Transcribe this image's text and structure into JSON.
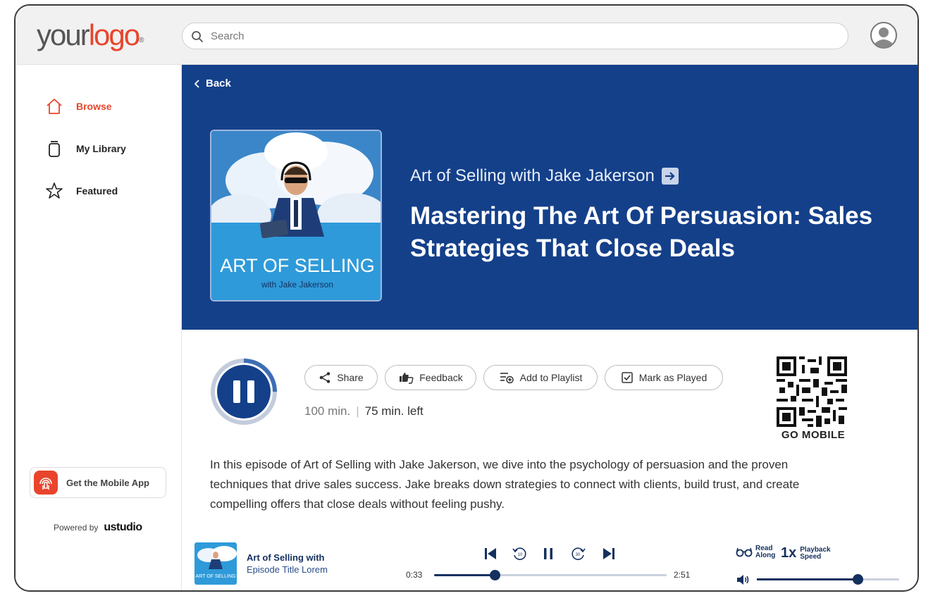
{
  "header": {
    "logo_part1": "your",
    "logo_part2": "logo",
    "logo_mark": "®",
    "search_placeholder": "Search",
    "avatar_icon": "user-avatar-icon"
  },
  "sidebar": {
    "items": [
      {
        "label": "Browse",
        "icon": "home-icon",
        "active": true
      },
      {
        "label": "My Library",
        "icon": "library-icon",
        "active": false
      },
      {
        "label": "Featured",
        "icon": "star-icon",
        "active": false
      }
    ],
    "get_app_label": "Get the Mobile App",
    "powered_by": "Powered by",
    "powered_brand": "ustudio"
  },
  "hero": {
    "back_label": "Back",
    "cover_title": "ART OF SELLING",
    "cover_subtitle": "with Jake Jakerson",
    "show_title": "Art of Selling with Jake Jakerson",
    "episode_title": "Mastering The Art Of Persuasion: Sales Strategies That Close Deals"
  },
  "actions": {
    "share": "Share",
    "feedback": "Feedback",
    "add_to_playlist": "Add to Playlist",
    "mark_as_played": "Mark as Played"
  },
  "duration": {
    "total": "100 min.",
    "remaining": "75 min. left",
    "progress_fraction": 0.25
  },
  "qr": {
    "label": "GO MOBILE"
  },
  "description": "In this episode of Art of Selling with Jake Jakerson, we dive into the psychology of persuasion and the proven techniques that drive sales success. Jake breaks down strategies to connect with clients, build trust, and create compelling offers that close deals without feeling pushy.",
  "player": {
    "thumb_title": "ART OF SELLING",
    "title": "Art of Selling with",
    "subtitle": "Episode Title Lorem",
    "current_time": "0:33",
    "total_time": "2:51",
    "progress_fraction": 0.26,
    "skip_back_label": "10",
    "skip_forward_label": "30",
    "read_along_line1": "Read",
    "read_along_line2": "Along",
    "speed": "1x",
    "speed_line1": "Playback",
    "speed_line2": "Speed",
    "volume_fraction": 0.71
  },
  "colors": {
    "accent": "#e8452c",
    "hero_bg": "#14408a",
    "player_dark": "#14305f"
  }
}
